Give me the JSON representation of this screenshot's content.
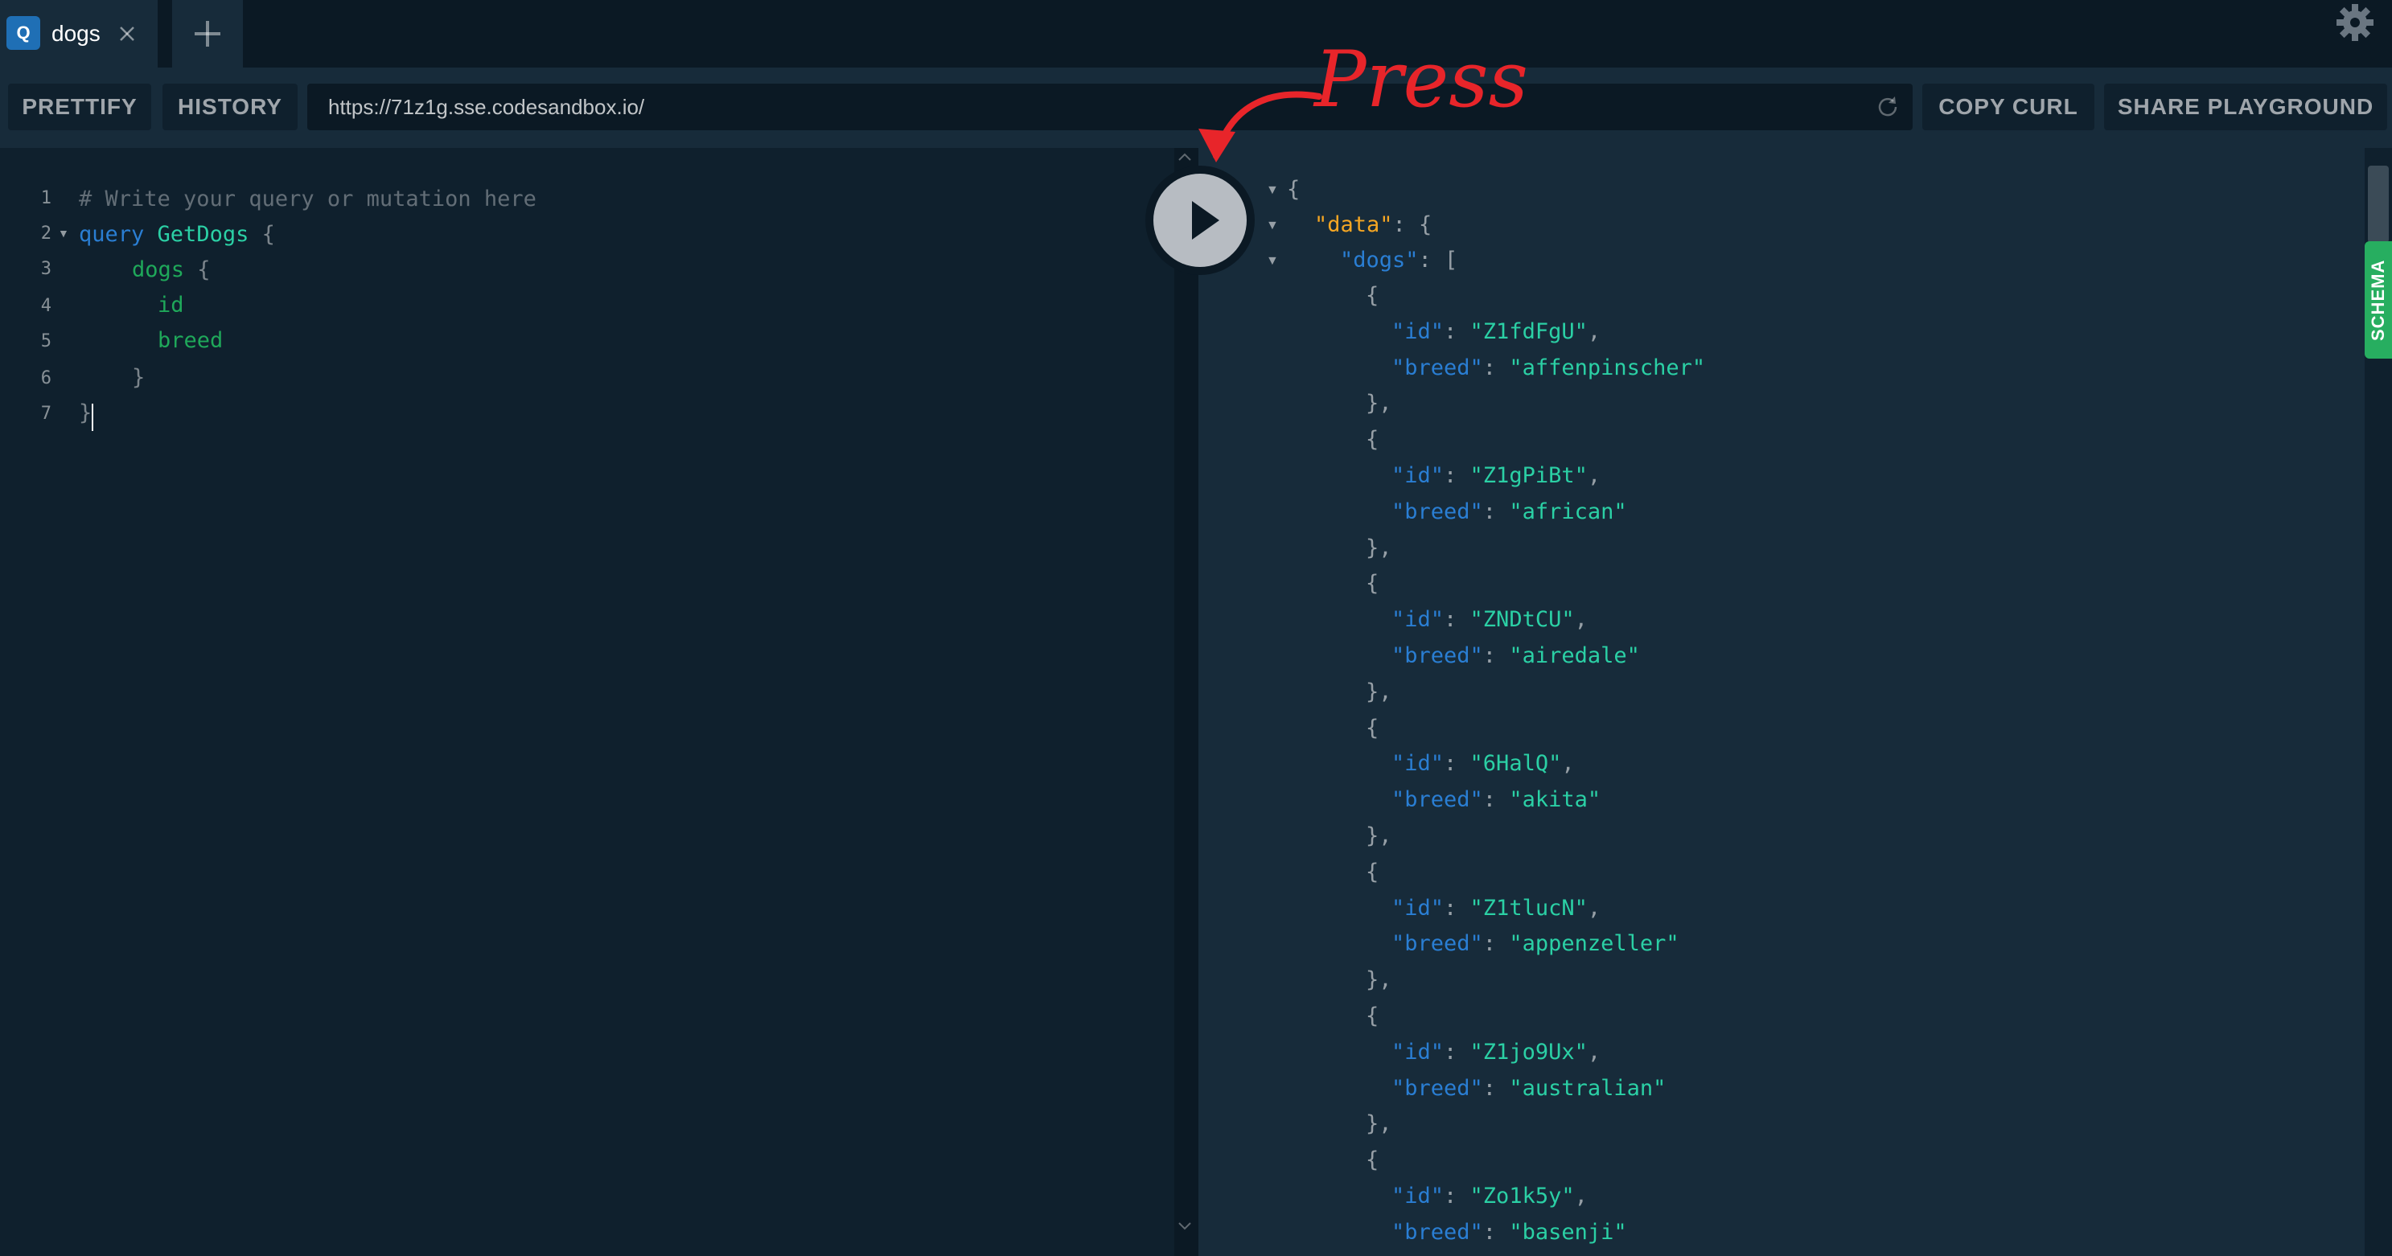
{
  "tabs": [
    {
      "badge": "Q",
      "title": "dogs"
    }
  ],
  "toolbar": {
    "prettify_label": "PRETTIFY",
    "history_label": "HISTORY",
    "url": "https://71z1g.sse.codesandbox.io/",
    "copy_curl_label": "COPY CURL",
    "share_label": "SHARE PLAYGROUND"
  },
  "editor": {
    "line_numbers": [
      "1",
      "2",
      "3",
      "4",
      "5",
      "6",
      "7"
    ],
    "comment": "# Write your query or mutation here",
    "keyword": "query",
    "operation_name": "GetDogs",
    "open_brace": "{",
    "field_dogs": "dogs",
    "field_id": "id",
    "field_breed": "breed",
    "close_inner": "}",
    "close_outer": "}"
  },
  "result": {
    "open": "{",
    "data_key": "\"data\"",
    "dogs_key": "\"dogs\"",
    "items": [
      {
        "id": "\"Z1fdFgU\"",
        "breed": "\"affenpinscher\""
      },
      {
        "id": "\"Z1gPiBt\"",
        "breed": "\"african\""
      },
      {
        "id": "\"ZNDtCU\"",
        "breed": "\"airedale\""
      },
      {
        "id": "\"6HalQ\"",
        "breed": "\"akita\""
      },
      {
        "id": "\"Z1tlucN\"",
        "breed": "\"appenzeller\""
      },
      {
        "id": "\"Z1jo9Ux\"",
        "breed": "\"australian\""
      },
      {
        "id": "\"Zo1k5y\"",
        "breed": "\"basenji\""
      }
    ]
  },
  "schema_label": "SCHEMA",
  "annotation": {
    "text": "Press",
    "color": "#e8252a"
  },
  "colors": {
    "accent": "#27ae60",
    "keyword": "#2a7ed3",
    "string": "#2bd0a5",
    "key_data": "#f5a623"
  },
  "icons": [
    "close-icon",
    "plus-icon",
    "gear-icon",
    "reload-icon",
    "play-icon",
    "chevron-up-icon",
    "chevron-down-icon"
  ]
}
